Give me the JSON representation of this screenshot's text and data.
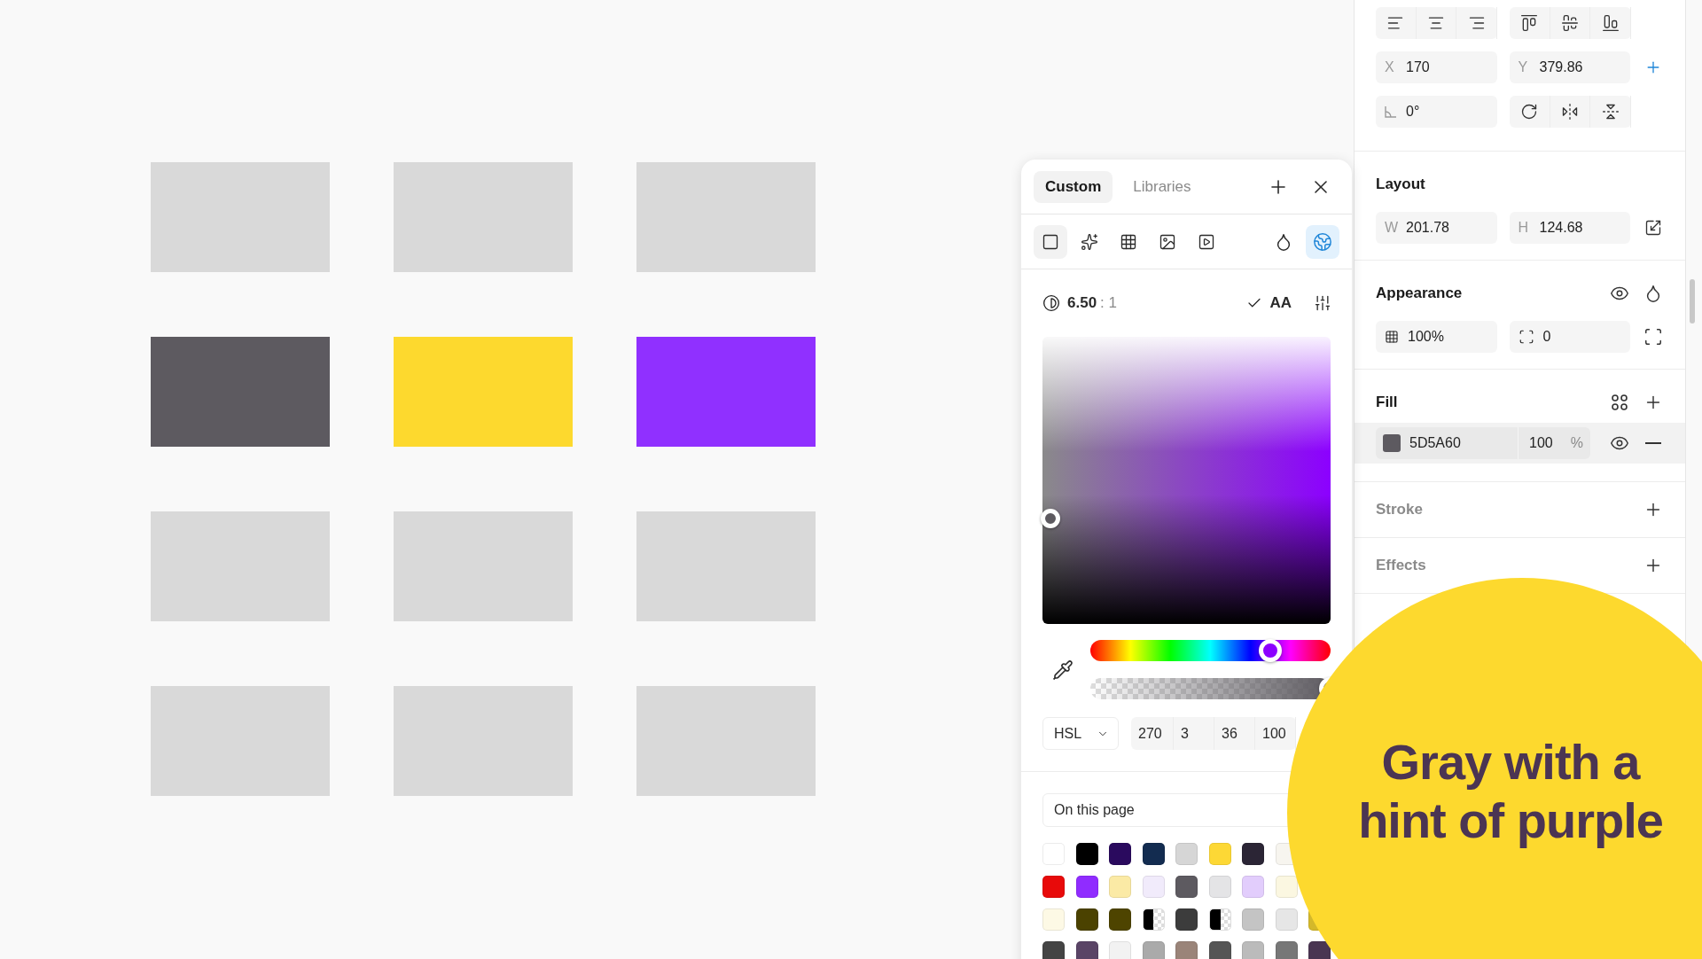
{
  "canvas": {
    "shapes": [
      {
        "color": "#d9d9d9"
      },
      {
        "color": "#d9d9d9"
      },
      {
        "color": "#d9d9d9"
      },
      {
        "color": "#5d5a60"
      },
      {
        "color": "#fdd92e"
      },
      {
        "color": "#9030ff"
      },
      {
        "color": "#d9d9d9"
      },
      {
        "color": "#d9d9d9"
      },
      {
        "color": "#d9d9d9"
      },
      {
        "color": "#d9d9d9"
      },
      {
        "color": "#d9d9d9"
      },
      {
        "color": "#d9d9d9"
      }
    ]
  },
  "color_picker": {
    "tabs": [
      {
        "label": "Custom",
        "selected": true
      },
      {
        "label": "Libraries",
        "selected": false
      }
    ],
    "paint_types": [
      {
        "kind": "solid",
        "selected": true
      },
      {
        "kind": "noise",
        "selected": false
      },
      {
        "kind": "pattern",
        "selected": false
      },
      {
        "kind": "image",
        "selected": false
      },
      {
        "kind": "video",
        "selected": false
      }
    ],
    "tools": [
      {
        "kind": "drop",
        "selected": false
      },
      {
        "kind": "space",
        "selected": true
      }
    ],
    "contrast": {
      "ratio": "6.50",
      "scale": ": 1",
      "rating": "AA"
    },
    "hue": {
      "level": 0.75
    },
    "alpha": {
      "level": 1
    },
    "model": "HSL",
    "values": [
      "270",
      "3",
      "36",
      "100"
    ],
    "palette": {
      "label": "On this page",
      "swatches": [
        {
          "kind": "solid",
          "color": "#ffffff"
        },
        {
          "kind": "solid",
          "color": "#000000"
        },
        {
          "kind": "solid",
          "color": "#2a0a5e"
        },
        {
          "kind": "solid",
          "color": "#132c50"
        },
        {
          "kind": "solid",
          "color": "#d6d6d6"
        },
        {
          "kind": "solid",
          "color": "#fdd835"
        },
        {
          "kind": "solid",
          "color": "#2b2535"
        },
        {
          "kind": "solid",
          "color": "#f7f5ef"
        },
        {
          "kind": "solid",
          "color": "#e80a0a"
        },
        {
          "kind": "solid",
          "color": "#902cff"
        },
        {
          "kind": "solid",
          "color": "#fbeaa5"
        },
        {
          "kind": "solid",
          "color": "#f1ebfb"
        },
        {
          "kind": "solid",
          "color": "#5d5a60"
        },
        {
          "kind": "solid",
          "color": "#e4e4e6"
        },
        {
          "kind": "solid",
          "color": "#e2cdfc"
        },
        {
          "kind": "solid",
          "color": "#fbf7e1"
        },
        {
          "kind": "solid",
          "color": "#fdf9e5"
        },
        {
          "kind": "solid",
          "color": "#4b4200"
        },
        {
          "kind": "solid",
          "color": "#4e4400"
        },
        {
          "kind": "mixed",
          "color": "#000000"
        },
        {
          "kind": "solid",
          "color": "#3c3c3c"
        },
        {
          "kind": "mixed",
          "color": "#000000"
        },
        {
          "kind": "solid",
          "color": "#c4c4c4"
        },
        {
          "kind": "solid",
          "color": "#e6e6e6"
        },
        {
          "kind": "solid",
          "color": "#d4b82a"
        },
        {
          "kind": "solid",
          "color": "#444444"
        },
        {
          "kind": "solid",
          "color": "#5a4466"
        },
        {
          "kind": "solid",
          "color": "#f2f2f2"
        },
        {
          "kind": "solid",
          "color": "#aaaaaa"
        },
        {
          "kind": "solid",
          "color": "#9a8479"
        },
        {
          "kind": "solid",
          "color": "#555555"
        },
        {
          "kind": "solid",
          "color": "#bbbbbb"
        },
        {
          "kind": "solid",
          "color": "#777777"
        },
        {
          "kind": "solid",
          "color": "#4a3552"
        }
      ]
    }
  },
  "inspector": {
    "x": {
      "label": "X",
      "value": "170"
    },
    "y": {
      "label": "Y",
      "value": "379.86"
    },
    "rotation": "0°",
    "layout": {
      "title": "Layout",
      "w": {
        "label": "W",
        "value": "201.78"
      },
      "h": {
        "label": "H",
        "value": "124.68"
      }
    },
    "appearance": {
      "title": "Appearance",
      "opacity": "100%",
      "radius": "0"
    },
    "fill": {
      "title": "Fill",
      "color": "#5d5a60",
      "hex": "5D5A60",
      "opacity": "100",
      "unit": "%"
    },
    "sections": [
      {
        "title": "Stroke"
      },
      {
        "title": "Effects"
      }
    ]
  },
  "caption": {
    "text": "Gray with a hint of purple"
  }
}
